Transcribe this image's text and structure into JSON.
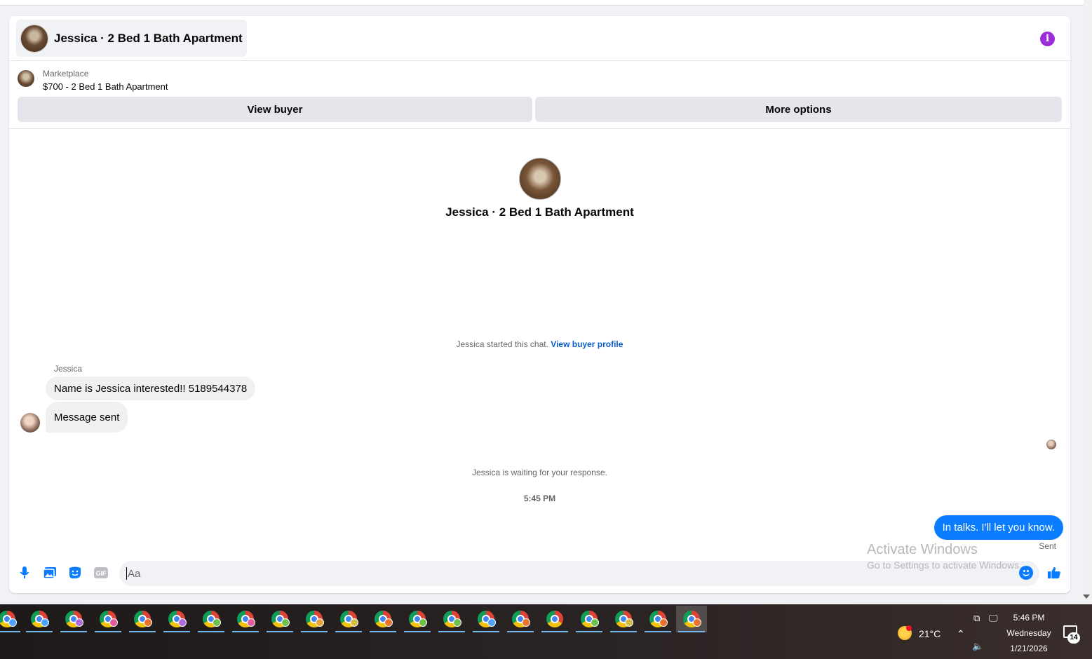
{
  "header": {
    "title": "Jessica · 2 Bed 1 Bath Apartment",
    "info_icon": "info-icon",
    "accent": "#9b2ed9"
  },
  "listing": {
    "source_label": "Marketplace",
    "price_title": "$700 - 2 Bed 1 Bath Apartment",
    "view_buyer_label": "View buyer",
    "more_options_label": "More options"
  },
  "conversation": {
    "hero_title": "Jessica · 2 Bed 1 Bath Apartment",
    "started_text": "Jessica started this chat.",
    "view_profile_link": "View buyer profile",
    "sender_name": "Jessica",
    "incoming": [
      "Name is Jessica interested!!  5189544378",
      "Message sent"
    ],
    "waiting_text": "Jessica is waiting for your response.",
    "timestamp": "5:45 PM",
    "outgoing": "In talks. I'll let you know.",
    "outgoing_status": "Sent",
    "outgoing_color": "#0a7cff"
  },
  "composer": {
    "placeholder": "Aa",
    "icons": [
      "microphone-icon",
      "photo-icon",
      "sticker-icon",
      "gif-icon",
      "emoji-icon",
      "thumbs-up-icon"
    ],
    "gif_label": "GIF"
  },
  "watermark": {
    "line1": "Activate Windows",
    "line2": "Go to Settings to activate Windows."
  },
  "taskbar": {
    "temperature": "21°C",
    "time": "5:46 PM",
    "day": "Wednesday",
    "date": "1/21/2026",
    "notification_count": "14"
  }
}
